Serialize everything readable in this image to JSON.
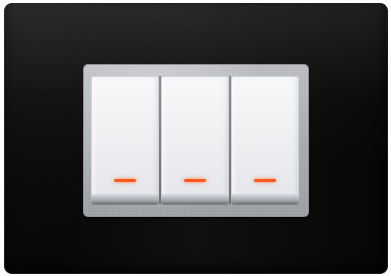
{
  "scene": {
    "subject": "",
    "plate_color": "#080808",
    "frame_color": "#a9acb1",
    "key_color": "#f0f2f4",
    "indicator_color": "#ff5a1f",
    "keys": [
      {
        "icon": "indicator-led-icon"
      },
      {
        "icon": "indicator-led-icon"
      },
      {
        "icon": "indicator-led-icon"
      }
    ]
  }
}
